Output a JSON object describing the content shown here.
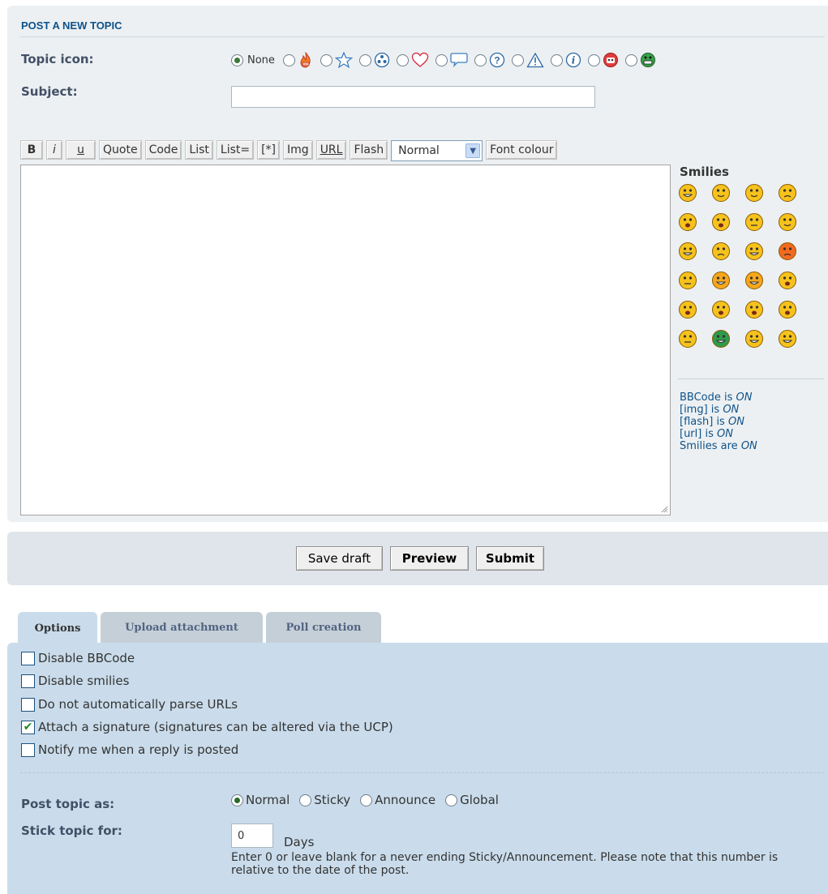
{
  "section_title": "POST A NEW TOPIC",
  "topic_icon": {
    "label": "Topic icon:",
    "none_label": "None",
    "options": [
      "fire-icon",
      "star-icon",
      "radiation-icon",
      "heart-icon",
      "speech-bubble-icon",
      "question-icon",
      "warning-icon",
      "info-icon",
      "sad-face-icon",
      "grin-face-icon"
    ]
  },
  "subject": {
    "label": "Subject:",
    "value": ""
  },
  "toolbar": {
    "bold": "B",
    "italic": "i",
    "underline": "u",
    "quote": "Quote",
    "code": "Code",
    "list": "List",
    "list_ordered": "List=",
    "list_item": "[*]",
    "img": "Img",
    "url": "URL",
    "flash": "Flash",
    "font_size": "Normal",
    "font_colour": "Font colour"
  },
  "message": {
    "value": ""
  },
  "smilies": {
    "title": "Smilies",
    "items": [
      {
        "icon": "grin-smiley-icon",
        "color": "#f6c21c"
      },
      {
        "icon": "smile-smiley-icon",
        "color": "#f6c21c"
      },
      {
        "icon": "wink-smiley-icon",
        "color": "#f6c21c"
      },
      {
        "icon": "sad-smiley-icon",
        "color": "#f6c21c"
      },
      {
        "icon": "surprised-smiley-icon",
        "color": "#f6c21c"
      },
      {
        "icon": "shocked-smiley-icon",
        "color": "#f6c21c"
      },
      {
        "icon": "confused-smiley-icon",
        "color": "#f6c21c"
      },
      {
        "icon": "cool-smiley-icon",
        "color": "#f6c21c"
      },
      {
        "icon": "laughing-smiley-icon",
        "color": "#f6c21c"
      },
      {
        "icon": "mad-smiley-icon",
        "color": "#f6c21c"
      },
      {
        "icon": "razz-smiley-icon",
        "color": "#f6c21c"
      },
      {
        "icon": "angry-smiley-icon",
        "color": "#f36a1f"
      },
      {
        "icon": "embarrassed-smiley-icon",
        "color": "#f6c21c"
      },
      {
        "icon": "evil-smiley-icon",
        "color": "#f6a71c"
      },
      {
        "icon": "twisted-smiley-icon",
        "color": "#f6a71c"
      },
      {
        "icon": "rolleyes-smiley-icon",
        "color": "#f6c21c"
      },
      {
        "icon": "exclaim-smiley-icon",
        "color": "#f6c21c"
      },
      {
        "icon": "question-smiley-icon",
        "color": "#f6c21c"
      },
      {
        "icon": "idea-smiley-icon",
        "color": "#f6c21c"
      },
      {
        "icon": "arrow-smiley-icon",
        "color": "#f6c21c"
      },
      {
        "icon": "neutral-smiley-icon",
        "color": "#f6c21c"
      },
      {
        "icon": "green-smiley-icon",
        "color": "#2f9a4b"
      },
      {
        "icon": "geek-smiley-icon",
        "color": "#f6c21c"
      },
      {
        "icon": "ugeek-smiley-icon",
        "color": "#f6c21c"
      }
    ]
  },
  "bbcode_status": {
    "bbcode": {
      "prefix": "BBCode is ",
      "state": "ON"
    },
    "img": {
      "prefix": "[img] is ",
      "state": "ON"
    },
    "flash": {
      "prefix": "[flash] is ",
      "state": "ON"
    },
    "url": {
      "prefix": "[url] is ",
      "state": "ON"
    },
    "smilies": {
      "prefix": "Smilies are ",
      "state": "ON"
    }
  },
  "submit_buttons": {
    "save_draft": "Save draft",
    "preview": "Preview",
    "submit": "Submit"
  },
  "tabs": [
    {
      "label": "Options",
      "active": true
    },
    {
      "label": "Upload attachment",
      "active": false
    },
    {
      "label": "Poll creation",
      "active": false
    }
  ],
  "options": {
    "disable_bbcode": {
      "label": "Disable BBCode",
      "checked": false
    },
    "disable_smilies": {
      "label": "Disable smilies",
      "checked": false
    },
    "disable_urls": {
      "label": "Do not automatically parse URLs",
      "checked": false
    },
    "attach_sig": {
      "label": "Attach a signature (signatures can be altered via the UCP)",
      "checked": true
    },
    "notify": {
      "label": "Notify me when a reply is posted",
      "checked": false
    }
  },
  "post_as": {
    "label": "Post topic as:",
    "choices": [
      "Normal",
      "Sticky",
      "Announce",
      "Global"
    ],
    "selected": "Normal"
  },
  "stick_for": {
    "label": "Stick topic for:",
    "value": "0",
    "unit": "Days",
    "hint": "Enter 0 or leave blank for a never ending Sticky/Announcement. Please note that this number is relative to the date of the post."
  },
  "colors": {
    "title_blue": "#105289",
    "panel_light": "#ecf0f2",
    "panel_blue": "#cadceb"
  }
}
